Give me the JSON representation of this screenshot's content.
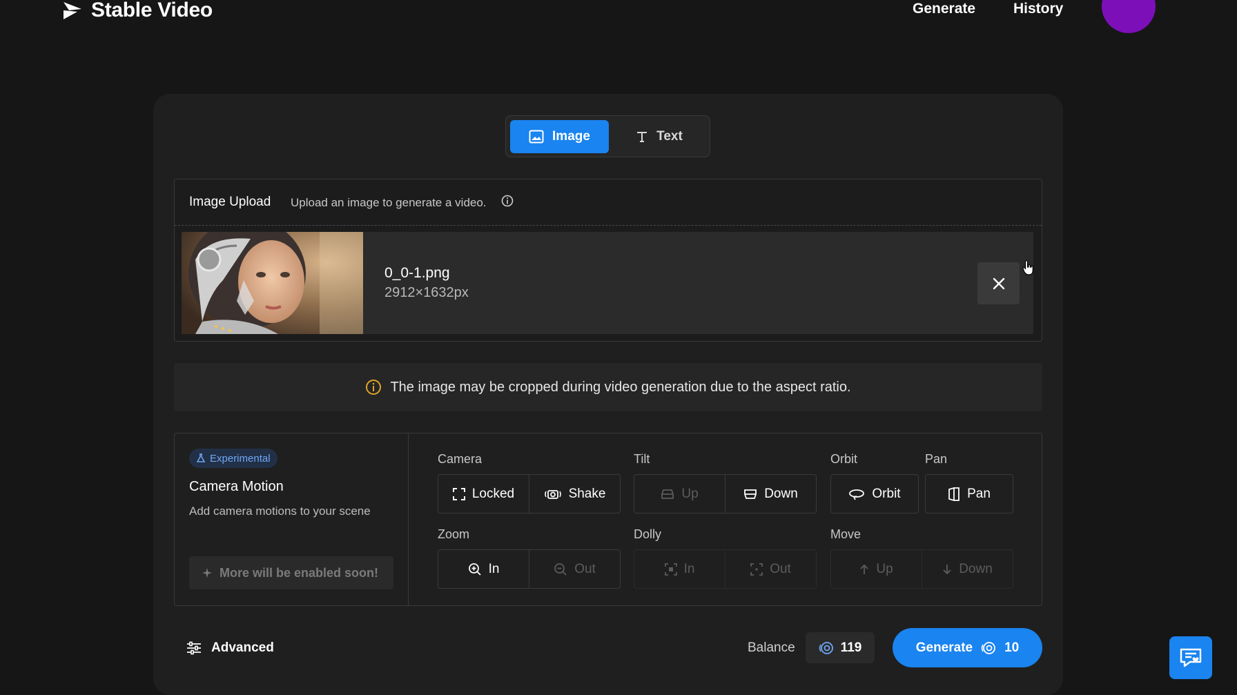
{
  "header": {
    "brand": "Stable Video",
    "nav": [
      "Generate",
      "History"
    ]
  },
  "mode_toggle": {
    "image_label": "Image",
    "text_label": "Text",
    "active": "Image"
  },
  "upload": {
    "title": "Image Upload",
    "subtitle": "Upload an image to generate a video.",
    "file_name": "0_0-1.png",
    "file_dims": "2912×1632px"
  },
  "warning": {
    "text": "The image may be cropped during video generation due to the aspect ratio."
  },
  "camera_motion": {
    "badge": "Experimental",
    "title": "Camera Motion",
    "subtitle": "Add camera motions to your scene",
    "soon": "More will be enabled soon!",
    "groups": {
      "camera": {
        "label": "Camera",
        "locked": "Locked",
        "shake": "Shake"
      },
      "tilt": {
        "label": "Tilt",
        "up": "Up",
        "down": "Down"
      },
      "orbit": {
        "label": "Orbit",
        "button": "Orbit"
      },
      "pan": {
        "label": "Pan",
        "button": "Pan"
      },
      "zoom": {
        "label": "Zoom",
        "in": "In",
        "out": "Out"
      },
      "dolly": {
        "label": "Dolly",
        "in": "In",
        "out": "Out"
      },
      "move": {
        "label": "Move",
        "up": "Up",
        "down": "Down"
      }
    }
  },
  "footer": {
    "advanced": "Advanced",
    "balance_label": "Balance",
    "balance_value": "119",
    "generate_label": "Generate",
    "generate_cost": "10"
  },
  "colors": {
    "accent": "#1a84f0",
    "avatar": "#7d0fb8",
    "warning_icon": "#e0a526"
  }
}
